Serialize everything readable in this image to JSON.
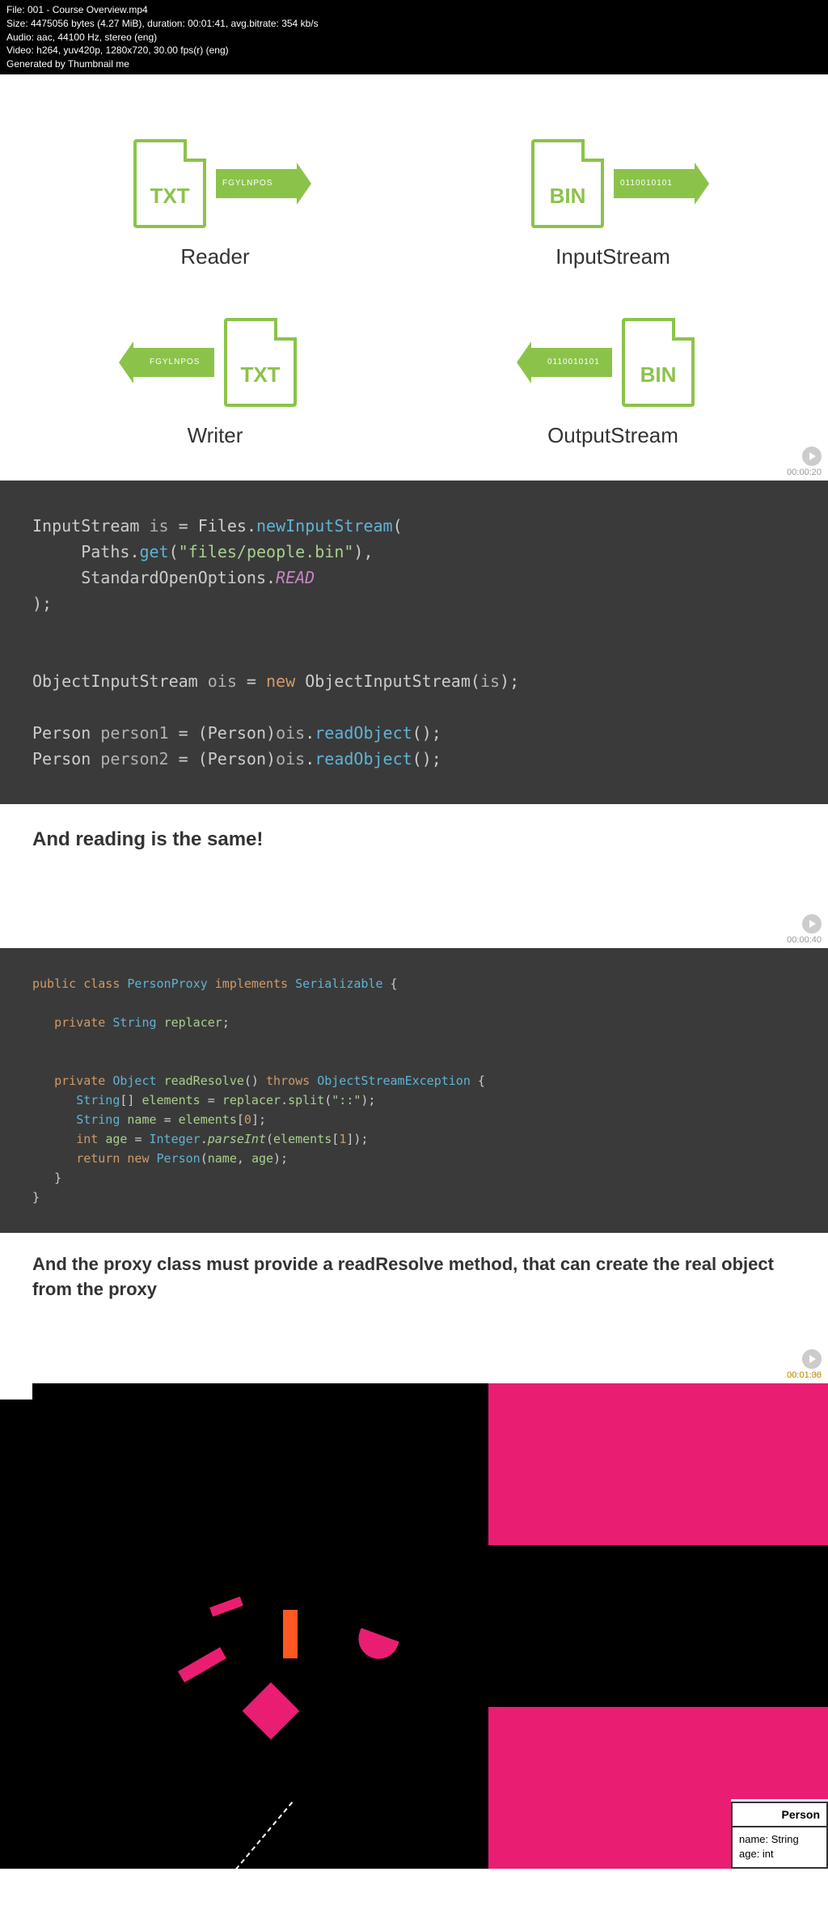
{
  "header": {
    "file": "File: 001 - Course Overview.mp4",
    "size": "Size: 4475056 bytes (4.27 MiB), duration: 00:01:41, avg.bitrate: 354 kb/s",
    "audio": "Audio: aac, 44100 Hz, stereo (eng)",
    "video": "Video: h264, yuv420p, 1280x720, 30.00 fps(r) (eng)",
    "generated": "Generated by Thumbnail me"
  },
  "io_items": [
    {
      "file_type": "TXT",
      "arrow_text": "FGYLNPOS",
      "direction": "right",
      "label": "Reader"
    },
    {
      "file_type": "BIN",
      "arrow_text": "0110010101",
      "direction": "right",
      "label": "InputStream"
    },
    {
      "file_type": "TXT",
      "arrow_text": "FGYLNPOS",
      "direction": "left",
      "label": "Writer"
    },
    {
      "file_type": "BIN",
      "arrow_text": "0110010101",
      "direction": "left",
      "label": "OutputStream"
    }
  ],
  "timestamps": [
    "00:00:20",
    "00:00:40",
    "00:01:00",
    "00:01:36"
  ],
  "code1_caption": "And reading is the same!",
  "code2_caption": "And the proxy class must provide a readResolve method, that can create the real object from the proxy",
  "person_card": {
    "title": "Person",
    "field1": "name: String",
    "field2": "age: int"
  },
  "code1": {
    "l1_type": "InputStream",
    "l1_var": "is",
    "l1_files": "Files",
    "l1_method": "newInputStream",
    "l2_paths": "Paths",
    "l2_get": "get",
    "l2_str": "\"files/people.bin\"",
    "l3_opts": "StandardOpenOptions",
    "l3_read": "READ",
    "l4_type": "ObjectInputStream",
    "l4_var": "ois",
    "l4_new": "new",
    "l4_ctor": "ObjectInputStream",
    "l4_arg": "is",
    "l5_type": "Person",
    "l5_var": "person1",
    "l5_cast": "Person",
    "l5_obj": "ois",
    "l5_method": "readObject",
    "l6_type": "Person",
    "l6_var": "person2",
    "l6_cast": "Person",
    "l6_obj": "ois",
    "l6_method": "readObject"
  },
  "code2": {
    "public": "public",
    "class": "class",
    "name": "PersonProxy",
    "implements": "implements",
    "serializable": "Serializable",
    "private": "private",
    "string": "String",
    "replacer": "replacer",
    "object": "Object",
    "readResolve": "readResolve",
    "throws": "throws",
    "exc": "ObjectStreamException",
    "elements": "elements",
    "split": "split",
    "sep": "\"::\"",
    "nameVar": "name",
    "idx0": "0",
    "int": "int",
    "age": "age",
    "integer": "Integer",
    "parseInt": "parseInt",
    "idx1": "1",
    "return": "return",
    "new": "new",
    "person": "Person"
  }
}
